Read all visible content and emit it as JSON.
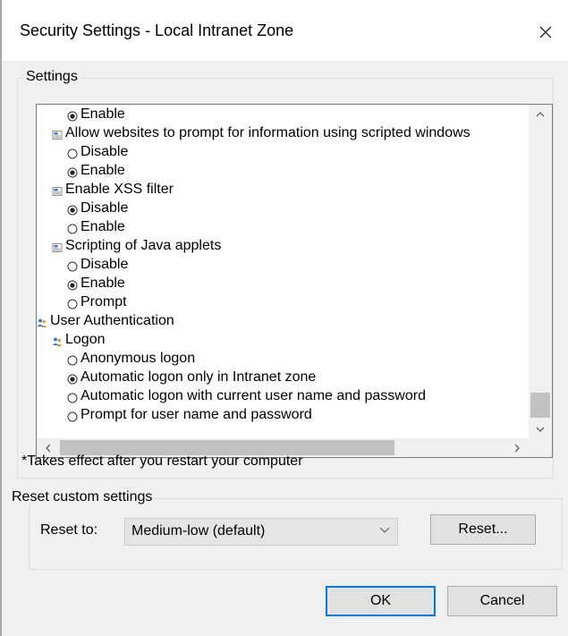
{
  "dialog": {
    "title": "Security Settings - Local Intranet Zone"
  },
  "settings_group": {
    "label": "Settings",
    "tree": [
      {
        "type": "radio",
        "checked": true,
        "level": 2,
        "label": "Enable"
      },
      {
        "type": "setting",
        "level": 1,
        "label": "Allow websites to prompt for information using scripted windows"
      },
      {
        "type": "radio",
        "checked": false,
        "level": 2,
        "label": "Disable"
      },
      {
        "type": "radio",
        "checked": true,
        "level": 2,
        "label": "Enable"
      },
      {
        "type": "setting",
        "level": 1,
        "label": "Enable XSS filter"
      },
      {
        "type": "radio",
        "checked": true,
        "level": 2,
        "label": "Disable"
      },
      {
        "type": "radio",
        "checked": false,
        "level": 2,
        "label": "Enable"
      },
      {
        "type": "setting",
        "level": 1,
        "label": "Scripting of Java applets"
      },
      {
        "type": "radio",
        "checked": false,
        "level": 2,
        "label": "Disable"
      },
      {
        "type": "radio",
        "checked": true,
        "level": 2,
        "label": "Enable"
      },
      {
        "type": "radio",
        "checked": false,
        "level": 2,
        "label": "Prompt"
      },
      {
        "type": "category",
        "level": 0,
        "label": "User Authentication"
      },
      {
        "type": "category",
        "level": 1,
        "label": "Logon"
      },
      {
        "type": "radio",
        "checked": false,
        "level": 2,
        "label": "Anonymous logon"
      },
      {
        "type": "radio",
        "checked": true,
        "level": 2,
        "label": "Automatic logon only in Intranet zone"
      },
      {
        "type": "radio",
        "checked": false,
        "level": 2,
        "label": "Automatic logon with current user name and password"
      },
      {
        "type": "radio",
        "checked": false,
        "level": 2,
        "label": "Prompt for user name and password"
      }
    ],
    "note": "*Takes effect after you restart your computer"
  },
  "reset_group": {
    "label": "Reset custom settings",
    "reset_to_label": "Reset to:",
    "selected": "Medium-low (default)",
    "reset_button": "Reset..."
  },
  "footer": {
    "ok": "OK",
    "cancel": "Cancel"
  },
  "icons": {
    "close": "close-icon",
    "radio_checked": "radio-checked-icon",
    "radio_unchecked": "radio-unchecked-icon",
    "setting": "setting-icon",
    "category": "users-icon",
    "scroll_up": "chevron-up-icon",
    "scroll_down": "chevron-down-icon",
    "scroll_left": "chevron-left-icon",
    "scroll_right": "chevron-right-icon",
    "dropdown": "chevron-down-icon"
  },
  "colors": {
    "accent": "#0078d7",
    "dialog_bg": "#f0f0f0"
  }
}
